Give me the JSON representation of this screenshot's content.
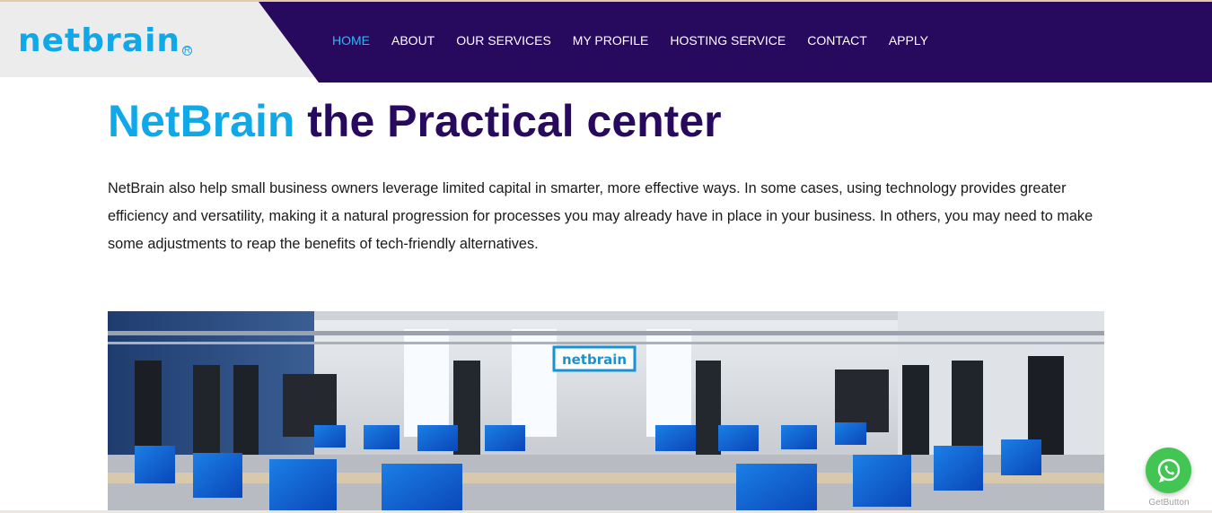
{
  "brand": {
    "logo_text": "netbrain",
    "logo_mark": "R",
    "colors": {
      "primary_blue": "#11a8e8",
      "navy": "#27095e",
      "header_gray": "#ececec",
      "active_nav": "#2fb8f5",
      "whatsapp": "#43c553"
    }
  },
  "nav": {
    "items": [
      {
        "label": "HOME",
        "active": true
      },
      {
        "label": "ABOUT",
        "active": false
      },
      {
        "label": "OUR SERVICES",
        "active": false
      },
      {
        "label": "MY PROFILE",
        "active": false
      },
      {
        "label": "HOSTING SERVICE",
        "active": false
      },
      {
        "label": "CONTACT",
        "active": false
      },
      {
        "label": "APPLY",
        "active": false
      }
    ]
  },
  "hero": {
    "title_highlight": "NetBrain",
    "title_rest": " the Practical center",
    "description": "NetBrain also help small business owners leverage limited capital in smarter, more effective ways. In some cases, using technology provides greater efficiency and versatility, making it a natural progression for processes you may already have in place in your business. In others, you may need to make some adjustments to reap the benefits of tech-friendly alternatives.",
    "photo_sign": "netbrain"
  },
  "widget": {
    "icon": "whatsapp-icon",
    "label": "GetButton"
  }
}
